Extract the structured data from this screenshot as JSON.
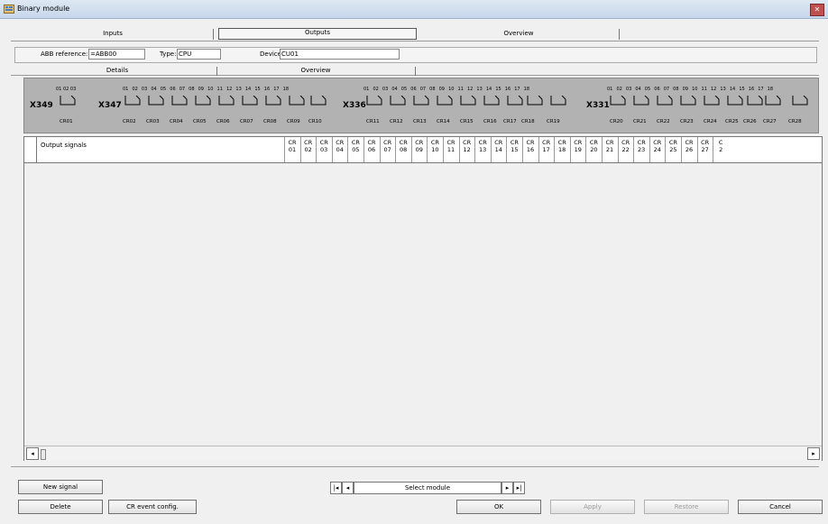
{
  "window": {
    "title": "Binary module",
    "close_label": "✕"
  },
  "tabs_top": [
    {
      "label": "Inputs"
    },
    {
      "label": "Outputs"
    },
    {
      "label": "Overview"
    }
  ],
  "fields": {
    "abb_reference": {
      "label": "ABB reference:",
      "value": "=ABB00"
    },
    "type": {
      "label": "Type:",
      "value": "CPU"
    },
    "device": {
      "label": "Device:",
      "value": "CU01"
    }
  },
  "tabs_sub": [
    {
      "label": "Details"
    },
    {
      "label": "Overview"
    }
  ],
  "terminals": [
    {
      "label": "X349",
      "pins": "01 02 03",
      "relays": [
        "CR01"
      ]
    },
    {
      "label": "X347",
      "pins": "01 02 03 04 05 06 07 08 09 10 11 12 13 14 15 16 17 18",
      "relays": [
        "CR02",
        "CR03",
        "CR04",
        "CR05",
        "CR06",
        "CR07",
        "CR08",
        "CR09",
        "CR10"
      ]
    },
    {
      "label": "X336",
      "pins": "01 02 03 04 05 06 07 08 09 10 11 12 13 14 15 16 17 18",
      "relays": [
        "CR11",
        "CR12",
        "CR13",
        "CR14",
        "CR15",
        "CR16",
        "CR17",
        "CR18",
        "CR19"
      ]
    },
    {
      "label": "X331",
      "pins": "01 02 03 04 05 06 07 08 09 10 11 12 13 14 15 16 17 18",
      "relays": [
        "CR20",
        "CR21",
        "CR22",
        "CR23",
        "CR24",
        "CR25",
        "CR26",
        "CR27",
        "CR28"
      ]
    }
  ],
  "table": {
    "first_header": "Output signals",
    "columns": [
      [
        "CR",
        "01"
      ],
      [
        "CR",
        "02"
      ],
      [
        "CR",
        "03"
      ],
      [
        "CR",
        "04"
      ],
      [
        "CR",
        "05"
      ],
      [
        "CR",
        "06"
      ],
      [
        "CR",
        "07"
      ],
      [
        "CR",
        "08"
      ],
      [
        "CR",
        "09"
      ],
      [
        "CR",
        "10"
      ],
      [
        "CR",
        "11"
      ],
      [
        "CR",
        "12"
      ],
      [
        "CR",
        "13"
      ],
      [
        "CR",
        "14"
      ],
      [
        "CR",
        "15"
      ],
      [
        "CR",
        "16"
      ],
      [
        "CR",
        "17"
      ],
      [
        "CR",
        "18"
      ],
      [
        "CR",
        "19"
      ],
      [
        "CR",
        "20"
      ],
      [
        "CR",
        "21"
      ],
      [
        "CR",
        "22"
      ],
      [
        "CR",
        "23"
      ],
      [
        "CR",
        "24"
      ],
      [
        "CR",
        "25"
      ],
      [
        "CR",
        "26"
      ],
      [
        "CR",
        "27"
      ],
      [
        "C",
        "2"
      ]
    ],
    "scroll_left": "◂",
    "scroll_right": "▸"
  },
  "buttons": {
    "new_signal": "New signal",
    "delete": "Delete",
    "cr_event_config": "CR event config.",
    "ok": "OK",
    "apply": "Apply",
    "restore": "Restore",
    "cancel": "Cancel"
  },
  "navigator": {
    "first": "|◂",
    "prev": "◂",
    "label": "Select module",
    "next": "▸",
    "last": "▸|"
  }
}
